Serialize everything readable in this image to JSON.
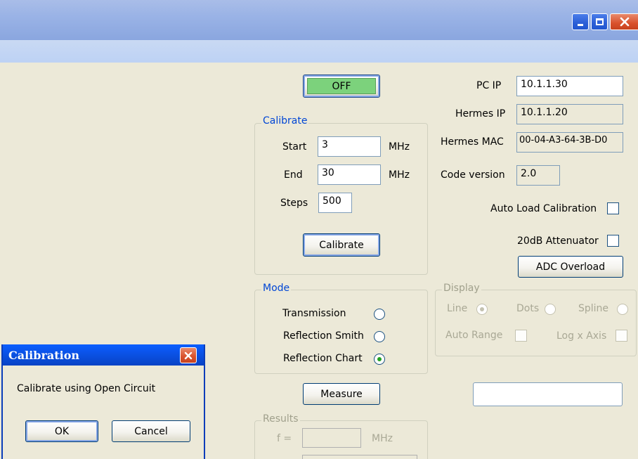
{
  "window": {
    "caption_buttons": {
      "minimize_icon": "minimize-icon",
      "maximize_icon": "maximize-icon",
      "close_icon": "close-icon"
    }
  },
  "controls": {
    "power_toggle_label": "OFF",
    "power_toggle_color": "#7cd27c"
  },
  "calibrate": {
    "legend": "Calibrate",
    "start_label": "Start",
    "start_value": "3",
    "start_unit": "MHz",
    "end_label": "End",
    "end_value": "30",
    "end_unit": "MHz",
    "steps_label": "Steps",
    "steps_value": "500",
    "button_label": "Calibrate"
  },
  "network": {
    "pc_ip_label": "PC IP",
    "pc_ip_value": "10.1.1.30",
    "hermes_ip_label": "Hermes IP",
    "hermes_ip_value": "10.1.1.20",
    "hermes_mac_label": "Hermes MAC",
    "hermes_mac_value": "00-04-A3-64-3B-D0",
    "code_version_label": "Code version",
    "code_version_value": "2.0"
  },
  "options": {
    "auto_load_label": "Auto Load Calibration",
    "auto_load_checked": false,
    "attenuator_label": "20dB Attenuator",
    "attenuator_checked": false,
    "adc_overload_label": "ADC Overload"
  },
  "mode": {
    "legend": "Mode",
    "items": [
      {
        "label": "Transmission",
        "selected": false
      },
      {
        "label": "Reflection Smith",
        "selected": false
      },
      {
        "label": "Reflection Chart",
        "selected": true
      }
    ]
  },
  "display": {
    "legend": "Display",
    "line_label": "Line",
    "dots_label": "Dots",
    "spline_label": "Spline",
    "auto_range_label": "Auto Range",
    "log_x_label": "Log x Axis"
  },
  "measure": {
    "button_label": "Measure",
    "status_value": ""
  },
  "results": {
    "legend": "Results",
    "f_label": "f =",
    "f_value": "",
    "f_unit": "MHz"
  },
  "dialog": {
    "title": "Calibration",
    "message": "Calibrate using Open Circuit",
    "ok_label": "OK",
    "cancel_label": "Cancel"
  },
  "colors": {
    "titlebar": "#9ab3e6",
    "client_bg": "#ece9d8",
    "groupbox_legend": "#0046d5",
    "dialog_title": "#0b53e8",
    "radio_selected_dot": "#21a121"
  }
}
